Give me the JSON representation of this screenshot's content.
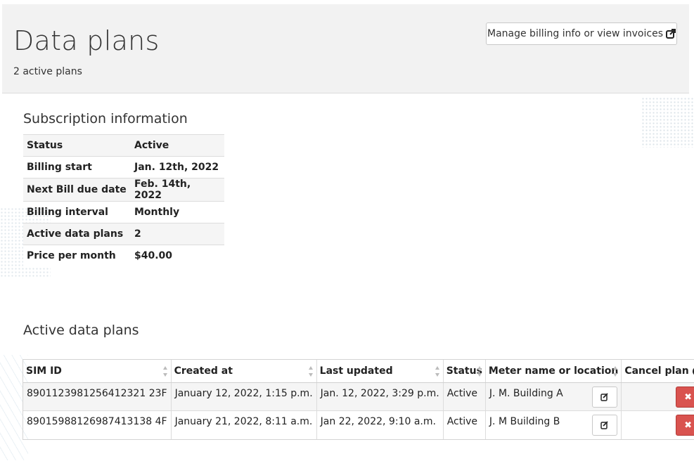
{
  "header": {
    "title": "Data plans",
    "subtitle": "2 active plans",
    "billing_button": "Manage billing info or view invoices",
    "billing_icon": "external-link-icon"
  },
  "subscription": {
    "title": "Subscription information",
    "rows": [
      {
        "label": "Status",
        "value": "Active"
      },
      {
        "label": "Billing start",
        "value": "Jan. 12th, 2022"
      },
      {
        "label": "Next Bill due date",
        "value": "Feb. 14th, 2022"
      },
      {
        "label": "Billing interval",
        "value": "Monthly"
      },
      {
        "label": "Active data plans",
        "value": "2"
      },
      {
        "label": "Price per month",
        "value": "$40.00"
      }
    ]
  },
  "plans": {
    "title": "Active data plans",
    "columns": [
      "SIM ID",
      "Created at",
      "Last updated",
      "Status",
      "Meter name or location",
      "Cancel plan"
    ],
    "rows": [
      {
        "sim": "8901123981256412321 23F",
        "created": "January 12, 2022, 1:15 p.m.",
        "updated": "Jan. 12, 2022, 3:29 p.m.",
        "status": "Active",
        "meter": "J. M. Building A"
      },
      {
        "sim": "89015988126987413138 4F",
        "created": "January 21, 2022, 8:11 a.m.",
        "updated": "Jan 22, 2022, 9:10 a.m.",
        "status": "Active",
        "meter": "J. M Building B"
      }
    ]
  },
  "colors": {
    "danger": "#d9534f",
    "header_bg": "#f2f2f2"
  }
}
